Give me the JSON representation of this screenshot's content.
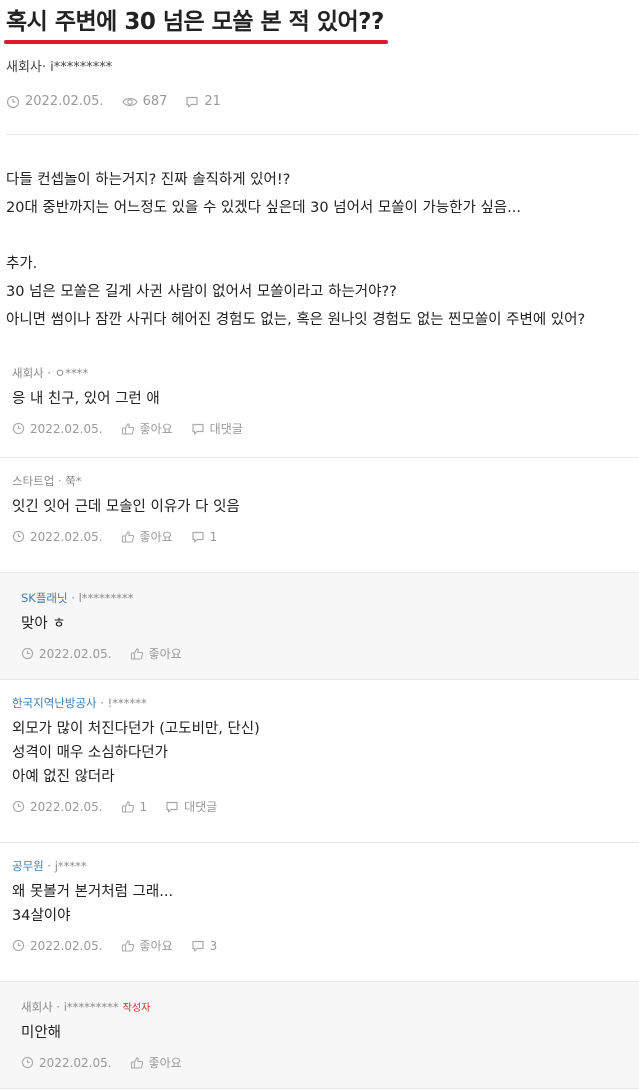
{
  "post": {
    "title": "혹시 주변에 30 넘은 모쏠 본 적 있어??",
    "author": "새회사· i*********",
    "date": "2022.02.05.",
    "views": "687",
    "comments_count": "21",
    "highlight_color": "#e3182d",
    "body_lines": [
      "다들 컨셉놀이 하는거지? 진짜 솔직하게 있어!?",
      "20대 중반까지는 어느정도 있을 수 있겠다 싶은데 30 넘어서 모쏠이 가능한가 싶음...",
      "",
      "추가.",
      "30 넘은 모쏠은 길게 사귄 사람이 없어서 모쏠이라고 하는거야??",
      "아니면 썸이나 잠깐 사귀다 헤어진 경험도 없는, 혹은 원나잇 경험도 없는 찐모쏠이 주변에 있어?"
    ]
  },
  "comments": [
    {
      "org": "새회사",
      "user": "ㅇ****",
      "text": [
        "응 내 친구, 있어 그런 애"
      ],
      "date": "2022.02.05.",
      "like": "좋아요",
      "reply": "대댓글",
      "is_reply": false,
      "org_link": false
    },
    {
      "org": "스타트업",
      "user": "쭉*",
      "text": [
        "잇긴 잇어 근데 모솔인 이유가 다 잇음"
      ],
      "date": "2022.02.05.",
      "like": "좋아요",
      "reply": "1",
      "is_reply": false,
      "org_link": false
    },
    {
      "org": "SK플래닛",
      "user": "l*********",
      "text": [
        "맞아 ㅎ"
      ],
      "date": "2022.02.05.",
      "like": "좋아요",
      "reply": "",
      "is_reply": true,
      "org_link": true
    },
    {
      "org": "한국지역난방공사",
      "user": "!******",
      "text": [
        "외모가 많이 처진다던가 (고도비만, 단신)",
        "성격이 매우 소심하다던가",
        "아예 없진 않더라"
      ],
      "date": "2022.02.05.",
      "like": "1",
      "reply": "대댓글",
      "is_reply": false,
      "org_link": true
    },
    {
      "org": "공무원",
      "user": "j*****",
      "text": [
        "왜 못볼거 본거처럼 그래...",
        "34살이야"
      ],
      "date": "2022.02.05.",
      "like": "좋아요",
      "reply": "3",
      "is_reply": false,
      "org_link": true
    },
    {
      "org": "새회사",
      "user": "i*********",
      "writer": "작성자",
      "text": [
        "미안해"
      ],
      "date": "2022.02.05.",
      "like": "좋아요",
      "reply": "",
      "is_reply": true,
      "org_link": false
    }
  ]
}
